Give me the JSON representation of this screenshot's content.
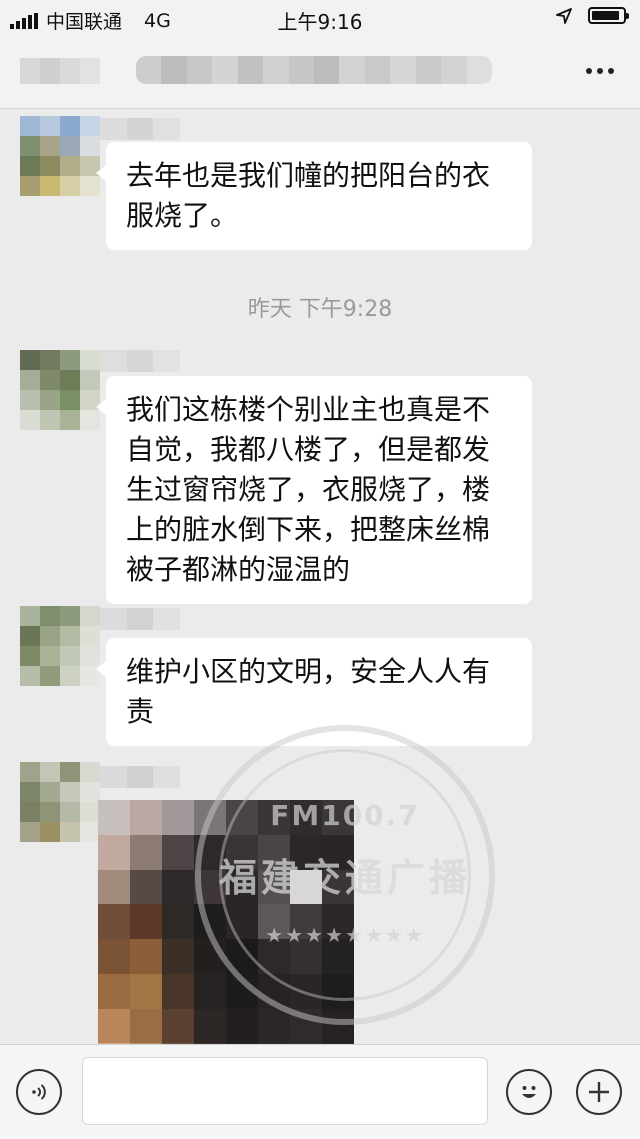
{
  "status_bar": {
    "carrier": "中国联通",
    "network": "4G",
    "time": "上午9:16",
    "battery_level": 0.9
  },
  "nav": {
    "more_icon": "more-dots-icon"
  },
  "messages": [
    {
      "type": "text",
      "text": "去年也是我们幢的把阳台的衣服烧了。"
    },
    {
      "type": "timestamp",
      "text": "昨天 下午9:28"
    },
    {
      "type": "text",
      "text": "我们这栋楼个别业主也真是不自觉，我都八楼了，但是都发生过窗帘烧了，衣服烧了，楼上的脏水倒下来，把整床丝棉被子都淋的湿温的"
    },
    {
      "type": "text",
      "text": "维护小区的文明，安全人人有责"
    },
    {
      "type": "image"
    }
  ],
  "watermark": {
    "line1": "FM100.7",
    "line2": "福建交通广播",
    "stars": "★★★★★★★★"
  },
  "input_bar": {
    "voice_icon": "voice-icon",
    "emoji_icon": "emoji-icon",
    "plus_icon": "plus-icon"
  },
  "colors": {
    "background": "#ebebeb",
    "bubble": "#ffffff",
    "timestamp": "#9a9a9a"
  }
}
